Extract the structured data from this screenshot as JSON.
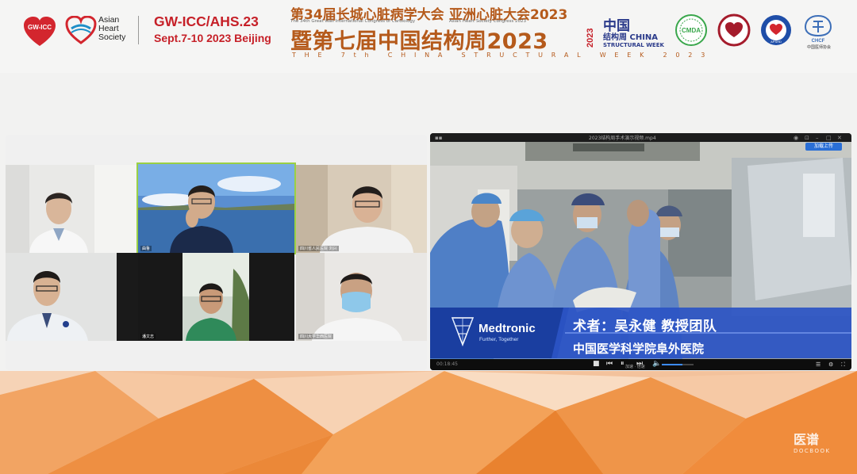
{
  "header": {
    "gwicc_logo_text": "GW-ICC",
    "ahs_lines": [
      "Asian",
      "Heart",
      "Society"
    ],
    "congress_title": "GW-ICC/AHS.23",
    "congress_date": "Sept.7-10 2023 Beijing",
    "cn_congress_a": "第34届长城心脏病学大会",
    "cn_congress_b": "亚洲心脏大会2023",
    "en_congress_a": "The 34th Great Wall International Congress of Cardiology",
    "en_congress_b": "Asian Heart Society Congress 2023",
    "cn_event": "暨第七届中国结构周2023",
    "en_event": "THE 7th CHINA STRUCTURAL WEEK 2023",
    "csw_year": "2023",
    "csw_cn_a": "中国",
    "csw_cn_b": "结构周",
    "csw_china": "CHINA",
    "csw_en": "STRUCTURAL WEEK",
    "cmda_logo_text": "CMDA",
    "apshd_logo_text": "APSHD",
    "chcf_logo_text": "CHCF",
    "chcf_cn": "中国医师协会"
  },
  "colors": {
    "brand_red": "#c62028",
    "brand_orange": "#b55a1b",
    "csw_blue": "#2a3a8a",
    "medtronic_blue": "#1a3ea0"
  },
  "video_grid": {
    "tiles": [
      {
        "name": "participant-1",
        "label": ""
      },
      {
        "name": "participant-2",
        "label": "曲鲁"
      },
      {
        "name": "participant-3",
        "label": "四川省人民医院 刘兴"
      },
      {
        "name": "participant-4",
        "label": ""
      },
      {
        "name": "participant-5",
        "label": "潘文志"
      },
      {
        "name": "participant-6",
        "label": "四川大学华西医院"
      }
    ]
  },
  "video_player": {
    "title": "2023结构周手术演示视频.mp4",
    "share_button": "加载上传",
    "time": "00:18:45",
    "speed_label": "加速 · 倍速"
  },
  "lower_third": {
    "brand": "Medtronic",
    "tagline": "Further, Together",
    "surgeon": "术者：吴永健 教授团队",
    "hospital": "中国医学科学院阜外医院"
  },
  "watermark": {
    "cn": "医谱",
    "en": "DOCBOOK"
  }
}
